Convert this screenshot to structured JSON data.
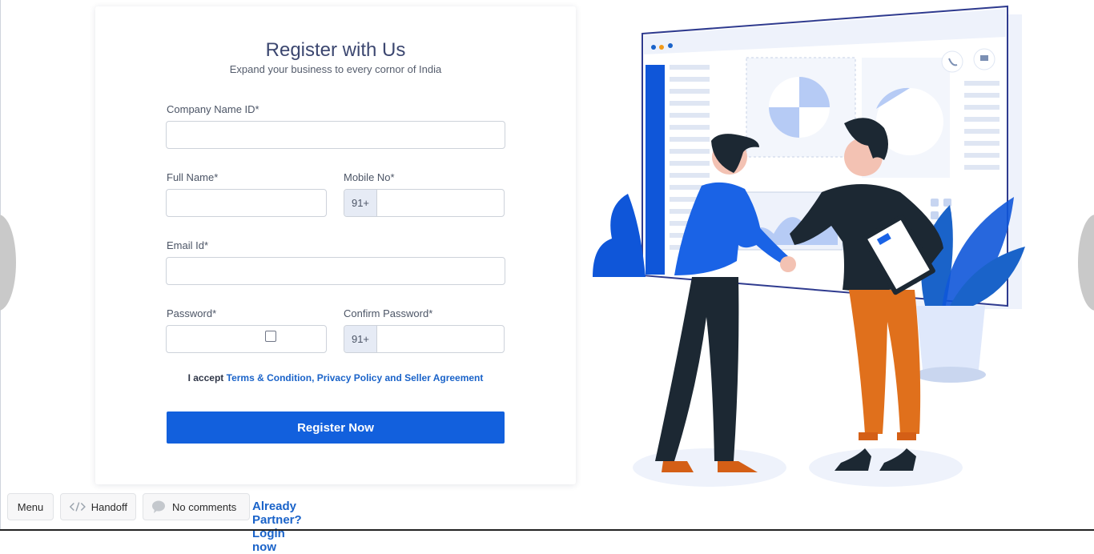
{
  "form": {
    "title": "Register with Us",
    "subtitle": "Expand your business to every cornor of India",
    "company_label": "Company Name ID*",
    "fullname_label": "Full Name*",
    "mobile_label": "Mobile No*",
    "mobile_prefix": "91+",
    "email_label": "Email Id*",
    "password_label": "Password*",
    "confirm_label": "Confirm Password*",
    "confirm_prefix": "91+",
    "terms_prefix": "I accept ",
    "terms_link": "Terms & Condition, Privacy Policy and Seller Agreement",
    "register_button": "Register Now"
  },
  "toolbar": {
    "menu_label": "Menu",
    "handoff_label": "Handoff",
    "comments_label": "No comments",
    "login_link": "Already Partner? Login now"
  },
  "colors": {
    "primary": "#1260dd",
    "link": "#1a63c9",
    "title": "#3c4770"
  }
}
